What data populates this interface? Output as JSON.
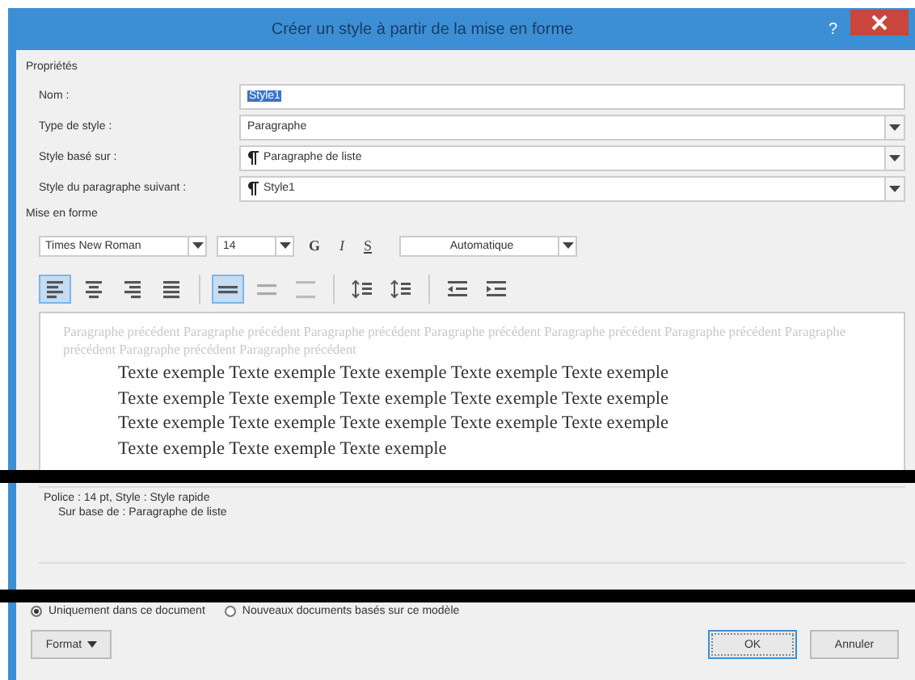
{
  "window": {
    "title": "Créer un style à partir de la mise en forme",
    "help": "?"
  },
  "properties": {
    "heading": "Propriétés",
    "fields": [
      {
        "label": "Nom :",
        "kind": "text",
        "value": "Style1",
        "selected": true
      },
      {
        "label": "Type de style :",
        "kind": "select",
        "value": "Paragraphe"
      },
      {
        "label": "Style basé sur :",
        "kind": "select",
        "value": "Paragraphe de liste",
        "pilcrow": true
      },
      {
        "label": "Style du paragraphe suivant :",
        "kind": "select",
        "value": "Style1",
        "pilcrow": true
      }
    ]
  },
  "formatting": {
    "heading": "Mise en forme",
    "font": "Times New Roman",
    "size": "14",
    "styles": [
      {
        "label": "G",
        "kind": "bold",
        "selected": false
      },
      {
        "label": "I",
        "kind": "italic",
        "selected": false
      },
      {
        "label": "S",
        "kind": "underline",
        "selected": false
      }
    ],
    "font_color_name": "Automatique",
    "tools": [
      {
        "kind": "align-left",
        "selected": true
      },
      {
        "kind": "align-center",
        "selected": false
      },
      {
        "kind": "align-right",
        "selected": false
      },
      {
        "kind": "justify",
        "selected": false
      },
      {
        "kind": "single-spacing",
        "selected": true
      },
      {
        "kind": "one-half-spacing",
        "selected": false
      },
      {
        "kind": "double-spacing",
        "selected": false
      },
      {
        "kind": "space-before",
        "selected": false
      },
      {
        "kind": "space-after",
        "selected": false
      },
      {
        "kind": "outdent",
        "selected": false
      },
      {
        "kind": "indent",
        "selected": false
      }
    ]
  },
  "preview": {
    "previous": "Paragraphe précédent Paragraphe précédent Paragraphe précédent Paragraphe précédent Paragraphe précédent Paragraphe précédent Paragraphe précédent Paragraphe précédent Paragraphe précédent",
    "sample": [
      "Texte exemple Texte exemple Texte exemple Texte exemple Texte exemple",
      "Texte exemple Texte exemple Texte exemple Texte exemple Texte exemple",
      "Texte exemple Texte exemple Texte exemple Texte exemple Texte exemple",
      "Texte exemple Texte exemple Texte exemple"
    ]
  },
  "description": [
    "Police : 14 pt, Style : Style rapide",
    "Sur base de : Paragraphe de liste"
  ],
  "scope": [
    {
      "label": "Uniquement dans ce document",
      "selected": true
    },
    {
      "label": "Nouveaux documents basés sur ce modèle",
      "selected": false
    }
  ],
  "buttons": {
    "format": "Format",
    "ok": "OK",
    "cancel": "Annuler"
  }
}
